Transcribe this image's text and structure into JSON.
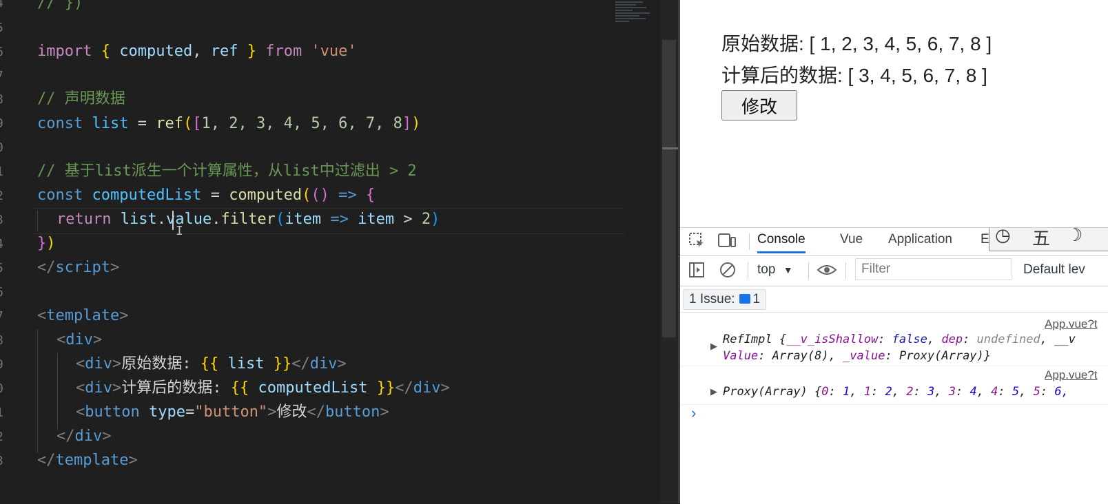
{
  "editor": {
    "gutter_numbers": [
      "4",
      "5",
      "6",
      "7",
      "8",
      "9",
      "0",
      "1",
      "2",
      "3",
      "4",
      "5",
      "6",
      "7",
      "8",
      "9",
      "0",
      "1",
      "2",
      "3"
    ],
    "line_0_comment": "// })",
    "import_line": {
      "k1": "import",
      "b1": "{",
      "n1": "computed",
      "c1": ",",
      "n2": "ref",
      "b2": "}",
      "k2": "from",
      "s": "'vue'"
    },
    "comment_declare": "// 声明数据",
    "list_line": {
      "k": "const",
      "v": "list",
      "eq": "=",
      "fn": "ref",
      "p1": "(",
      "b1": "[",
      "nums": "1, 2, 3, 4, 5, 6, 7, 8",
      "b2": "]",
      "p2": ")"
    },
    "comment_derive": "// 基于list派生一个计算属性，从list中过滤出 > 2",
    "computed_line": {
      "k": "const",
      "v": "computedList",
      "eq": "=",
      "fn": "computed",
      "p1": "(",
      "p2": "()",
      "arrow": "=>",
      "b": "{"
    },
    "return_line": {
      "k": "return",
      "a": "list",
      "d1": ".",
      "b": "value",
      "d2": ".",
      "fn": "filter",
      "p1": "(",
      "arg": "item",
      "arrow": "=>",
      "arg2": "item",
      "op": ">",
      "num": "2",
      "p2": ")"
    },
    "close_line": {
      "b": "}",
      "p": ")"
    },
    "script_close": {
      "lt": "</",
      "tag": "script",
      "gt": ">"
    },
    "template_open": {
      "lt": "<",
      "tag": "template",
      "gt": ">"
    },
    "div_open": {
      "lt": "<",
      "tag": "div",
      "gt": ">"
    },
    "div_list": {
      "lt": "<",
      "tag": "div",
      "gt": ">",
      "text": "原始数据: ",
      "m1": "{{",
      "v": "list",
      "m2": "}}",
      "lt2": "</",
      "tag2": "div",
      "gt2": ">"
    },
    "div_computed": {
      "lt": "<",
      "tag": "div",
      "gt": ">",
      "text": "计算后的数据: ",
      "m1": "{{",
      "v": "computedList",
      "m2": "}}",
      "lt2": "</",
      "tag2": "div",
      "gt2": ">"
    },
    "button_line": {
      "lt": "<",
      "tag": "button",
      "attr": "type",
      "eq": "=",
      "val": "\"button\"",
      "gt": ">",
      "text": "修改",
      "lt2": "</",
      "tag2": "button",
      "gt2": ">"
    },
    "div_close": {
      "lt": "</",
      "tag": "div",
      "gt": ">"
    },
    "template_close": {
      "lt": "</",
      "tag": "template",
      "gt": ">"
    },
    "ibeam": "I"
  },
  "preview": {
    "original_label": "原始数据: [ 1, 2, 3, 4, 5, 6, 7, 8 ]",
    "computed_label": "计算后的数据: [ 3, 4, 5, 6, 7, 8 ]",
    "modify_button": "修改"
  },
  "devtools": {
    "tabs": [
      "Console",
      "Vue",
      "Application",
      "E"
    ],
    "active_tab": "Console",
    "context": "top",
    "context_arrow": "▼",
    "filter_placeholder": "Filter",
    "levels": "Default lev",
    "issues_label": "1 Issue:",
    "issues_count": "1",
    "ext_icons": [
      "◷",
      "五",
      "☽"
    ],
    "logs": [
      {
        "source": "App.vue?t",
        "line1": {
          "a": "RefImpl {",
          "k1": "__v_isShallow",
          "c1": ": ",
          "v1": "false",
          "s1": ", ",
          "k2": "dep",
          "c2": ": ",
          "v2": "undefined",
          "s2": ", __v"
        },
        "line2": {
          "k3": "Value",
          "c3": ": ",
          "v3": "Array(8)",
          "s3": ", ",
          "k4": "_value",
          "c4": ": ",
          "v4": "Proxy(Array)",
          "e": "}"
        }
      },
      {
        "source": "App.vue?t",
        "line1": {
          "a": "Proxy(Array) {",
          "k0": "0",
          "v0": "1",
          "k1": "1",
          "v1": "2",
          "k2": "2",
          "v2": "3",
          "k3": "3",
          "v3": "4",
          "k4": "4",
          "v4": "5",
          "k5": "5",
          "v5": "6,"
        }
      }
    ],
    "arrow": "▶",
    "prompt": "›"
  }
}
